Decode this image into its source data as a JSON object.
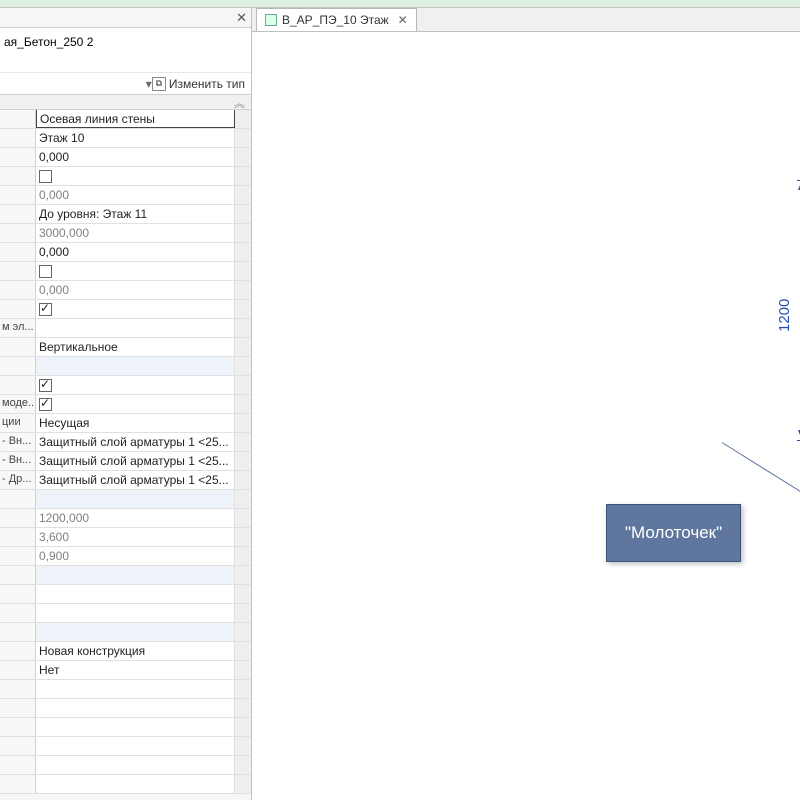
{
  "tab": {
    "label": "В_АР_ПЭ_10 Этаж"
  },
  "type_selector": {
    "name": "ая_Бетон_250 2"
  },
  "edit_type_label": "Изменить тип",
  "properties": [
    {
      "label": "",
      "value": "Осевая линия стены",
      "outlined": true
    },
    {
      "label": "",
      "value": "Этаж 10"
    },
    {
      "label": "",
      "value": "0,000"
    },
    {
      "label": "",
      "value": "",
      "checkbox": true,
      "checked": false
    },
    {
      "label": "",
      "value": "0,000",
      "gray": true
    },
    {
      "label": "",
      "value": "До уровня: Этаж 11"
    },
    {
      "label": "",
      "value": "3000,000",
      "gray": true
    },
    {
      "label": "",
      "value": "0,000"
    },
    {
      "label": "",
      "value": "",
      "checkbox": true,
      "checked": false
    },
    {
      "label": "",
      "value": "0,000",
      "gray": true
    },
    {
      "label": "",
      "value": "",
      "checkbox": true,
      "checked": true
    },
    {
      "label": "м эл...",
      "value": ""
    },
    {
      "label": "",
      "value": "Вертикальное"
    },
    {
      "label": "",
      "value": "",
      "group": true
    },
    {
      "label": "",
      "value": "",
      "checkbox": true,
      "checked": true
    },
    {
      "label": "моде...",
      "value": "",
      "checkbox": true,
      "checked": true
    },
    {
      "label": "ции",
      "value": "Несущая"
    },
    {
      "label": "- Вн...",
      "value": "Защитный слой арматуры 1 <25..."
    },
    {
      "label": "- Вн...",
      "value": "Защитный слой арматуры 1 <25..."
    },
    {
      "label": "- Др...",
      "value": "Защитный слой арматуры 1 <25..."
    },
    {
      "label": "",
      "value": "",
      "group": true
    },
    {
      "label": "",
      "value": "1200,000",
      "gray": true
    },
    {
      "label": "",
      "value": "3,600",
      "gray": true
    },
    {
      "label": "",
      "value": "0,900",
      "gray": true
    },
    {
      "label": "",
      "value": "",
      "group": true
    },
    {
      "label": "",
      "value": ""
    },
    {
      "label": "",
      "value": ""
    },
    {
      "label": "",
      "value": "",
      "group": true
    },
    {
      "label": "",
      "value": "Новая конструкция"
    },
    {
      "label": "",
      "value": "Нет"
    },
    {
      "label": "",
      "value": ""
    },
    {
      "label": "",
      "value": ""
    },
    {
      "label": "",
      "value": ""
    },
    {
      "label": "",
      "value": ""
    },
    {
      "label": "",
      "value": ""
    },
    {
      "label": "",
      "value": ""
    }
  ],
  "dimension": {
    "value": "1200"
  },
  "callout": {
    "text": "\"Молоточек\""
  }
}
